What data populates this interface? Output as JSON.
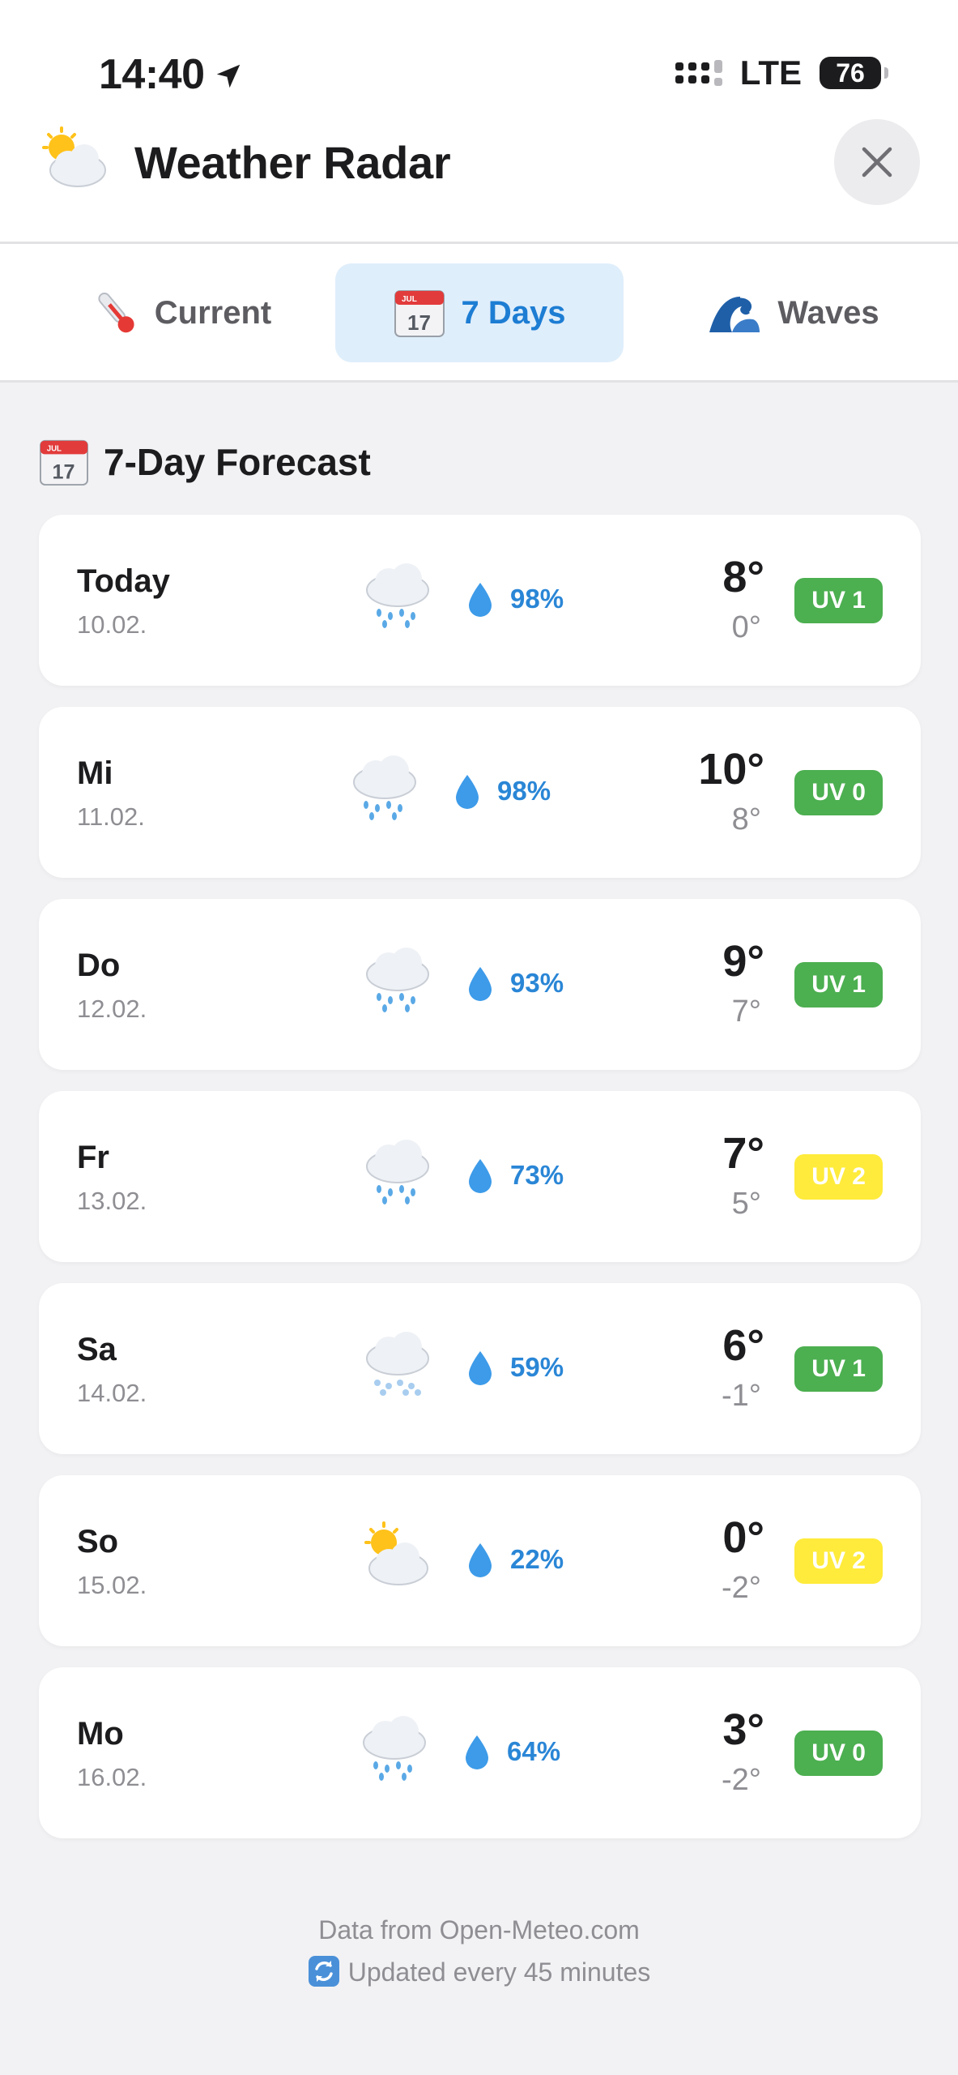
{
  "status_bar": {
    "time": "14:40",
    "network": "LTE",
    "battery": "76"
  },
  "header": {
    "title": "Weather Radar",
    "icon": "sun-behind-cloud-icon"
  },
  "tabs": [
    {
      "label": "Current",
      "icon": "thermometer-icon",
      "active": false
    },
    {
      "label": "7 Days",
      "icon": "calendar-icon",
      "active": true
    },
    {
      "label": "Waves",
      "icon": "wave-icon",
      "active": false
    }
  ],
  "section": {
    "title": "7-Day Forecast",
    "icon": "calendar-icon"
  },
  "forecast": [
    {
      "day": "Today",
      "date": "10.02.",
      "icon": "rain-cloud-icon",
      "precip": "98%",
      "high": "8°",
      "low": "0°",
      "uv": "UV 1",
      "uv_color": "#4caf50"
    },
    {
      "day": "Mi",
      "date": "11.02.",
      "icon": "rain-cloud-icon",
      "precip": "98%",
      "high": "10°",
      "low": "8°",
      "uv": "UV 0",
      "uv_color": "#4caf50"
    },
    {
      "day": "Do",
      "date": "12.02.",
      "icon": "rain-cloud-icon",
      "precip": "93%",
      "high": "9°",
      "low": "7°",
      "uv": "UV 1",
      "uv_color": "#4caf50"
    },
    {
      "day": "Fr",
      "date": "13.02.",
      "icon": "rain-cloud-icon",
      "precip": "73%",
      "high": "7°",
      "low": "5°",
      "uv": "UV 2",
      "uv_color": "#ffeb3b"
    },
    {
      "day": "Sa",
      "date": "14.02.",
      "icon": "snow-cloud-icon",
      "precip": "59%",
      "high": "6°",
      "low": "-1°",
      "uv": "UV 1",
      "uv_color": "#4caf50"
    },
    {
      "day": "So",
      "date": "15.02.",
      "icon": "sun-behind-cloud-icon",
      "precip": "22%",
      "high": "0°",
      "low": "-2°",
      "uv": "UV 2",
      "uv_color": "#ffeb3b"
    },
    {
      "day": "Mo",
      "date": "16.02.",
      "icon": "rain-cloud-icon",
      "precip": "64%",
      "high": "3°",
      "low": "-2°",
      "uv": "UV 0",
      "uv_color": "#4caf50"
    }
  ],
  "footer": {
    "source": "Data from Open-Meteo.com",
    "update": "Updated every 45 minutes"
  },
  "colors": {
    "accent": "#1d7dd3",
    "active_tab_bg": "#dfeefb",
    "precip": "#2a86d6",
    "uv_green": "#4caf50",
    "uv_yellow": "#ffeb3b"
  }
}
